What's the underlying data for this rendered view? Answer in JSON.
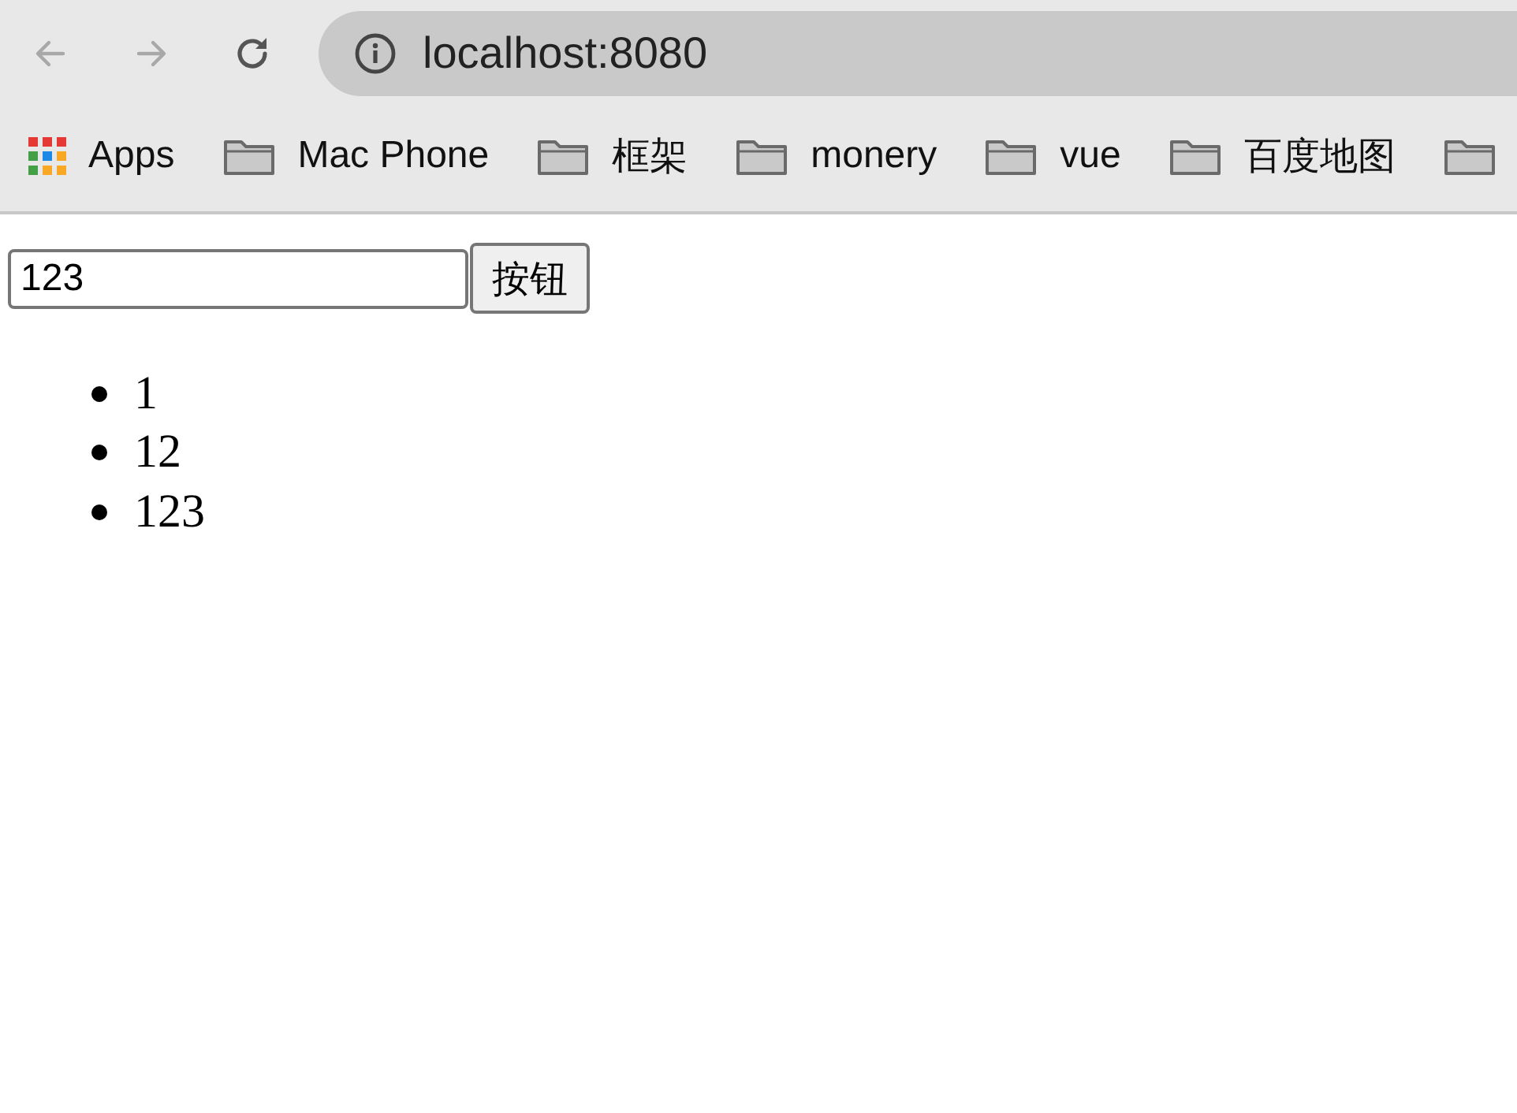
{
  "toolbar": {
    "nav": [
      {
        "kind": "back",
        "disabled": true
      },
      {
        "kind": "forward",
        "disabled": true
      },
      {
        "kind": "reload",
        "disabled": false
      }
    ],
    "address": "localhost:8080"
  },
  "bookmarks": [
    {
      "kind": "apps",
      "label": "Apps"
    },
    {
      "kind": "folder",
      "label": "Mac Phone"
    },
    {
      "kind": "folder",
      "label": "框架"
    },
    {
      "kind": "folder",
      "label": "monery"
    },
    {
      "kind": "folder",
      "label": "vue"
    },
    {
      "kind": "folder",
      "label": "百度地图"
    },
    {
      "kind": "folder-cut"
    }
  ],
  "page": {
    "input_value": "123",
    "button": "按钮",
    "items": [
      "1",
      "12",
      "123"
    ]
  }
}
